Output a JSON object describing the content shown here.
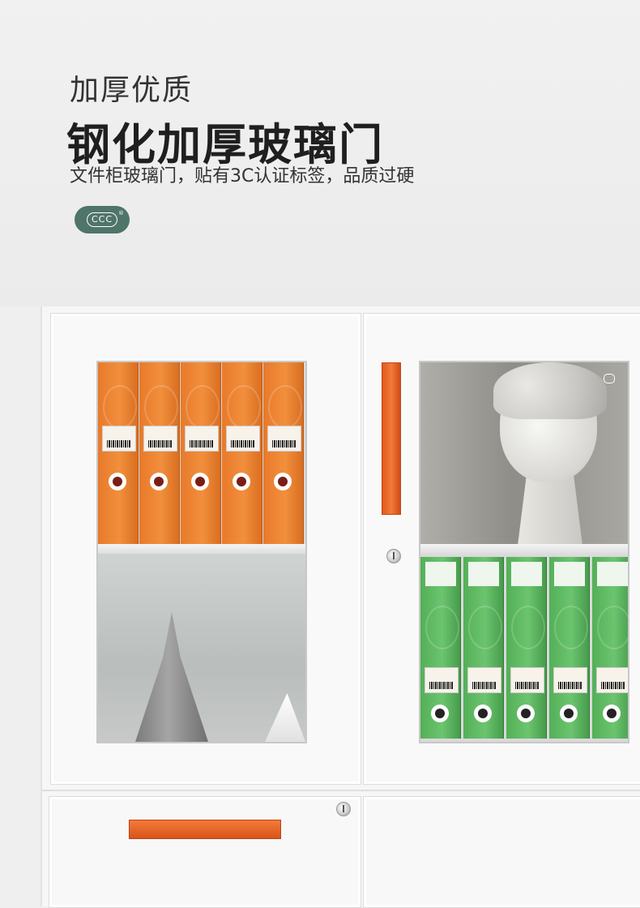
{
  "header": {
    "subtitle": "加厚优质",
    "headline": "钢化加厚玻璃门",
    "description": "文件柜玻璃门，贴有3C认证标签，品质过硬",
    "badge_text": "CCC",
    "badge_registered": "®"
  },
  "colors": {
    "badge": "#4f7469",
    "handle": "#ee6f2d",
    "orange_binders": "#f18f3d",
    "green_binders": "#6cc46f"
  },
  "icons": {
    "badge": "ccc-certification-icon",
    "lock": "lock-icon"
  }
}
